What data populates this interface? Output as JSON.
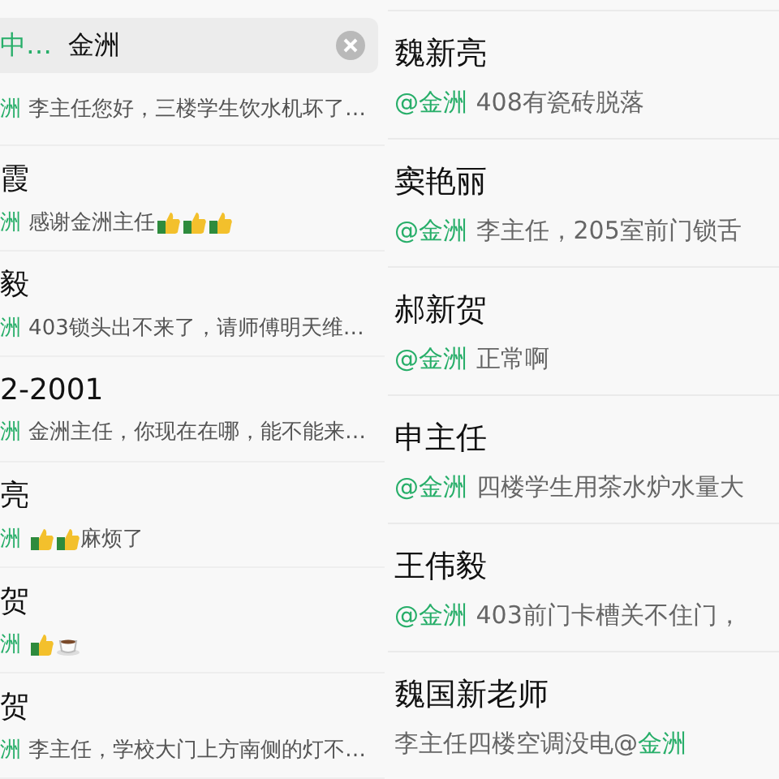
{
  "left_panel": {
    "search": {
      "scope": "中…",
      "value": "金洲"
    },
    "first_message": [
      {
        "kind": "mention",
        "text": "洲"
      },
      {
        "kind": "text",
        "text": "李主任您好，三楼学生饮水机坏了…"
      }
    ],
    "results": [
      {
        "name": "霞",
        "message": [
          {
            "kind": "mention",
            "text": "洲"
          },
          {
            "kind": "text",
            "text": "感谢金洲主任"
          },
          {
            "kind": "thumbs-up"
          },
          {
            "kind": "thumbs-up"
          },
          {
            "kind": "thumbs-up"
          }
        ]
      },
      {
        "name": "毅",
        "message": [
          {
            "kind": "mention",
            "text": "洲"
          },
          {
            "kind": "text",
            "text": "403锁头出不来了，请师傅明天维…"
          }
        ]
      },
      {
        "name": "2-2001",
        "message": [
          {
            "kind": "mention",
            "text": "洲"
          },
          {
            "kind": "text",
            "text": "金洲主任，你现在在哪，能不能来…"
          }
        ]
      },
      {
        "name": "亮",
        "message": [
          {
            "kind": "mention",
            "text": "洲"
          },
          {
            "kind": "thumbs-up"
          },
          {
            "kind": "thumbs-up"
          },
          {
            "kind": "text",
            "text": "麻烦了"
          }
        ]
      },
      {
        "name": "贺",
        "message": [
          {
            "kind": "mention",
            "text": "洲"
          },
          {
            "kind": "thumbs-up"
          },
          {
            "kind": "coffee"
          }
        ]
      },
      {
        "name": "贺",
        "message": [
          {
            "kind": "mention",
            "text": "洲"
          },
          {
            "kind": "text",
            "text": "李主任，学校大门上方南侧的灯不…"
          }
        ]
      }
    ]
  },
  "right_panel": {
    "results": [
      {
        "name": "魏新亮",
        "message": [
          {
            "kind": "mention",
            "text": "@金洲"
          },
          {
            "kind": "text",
            "text": "408有瓷砖脱落"
          }
        ]
      },
      {
        "name": "窦艳丽",
        "message": [
          {
            "kind": "mention",
            "text": "@金洲"
          },
          {
            "kind": "text",
            "text": "李主任，205室前门锁舌"
          }
        ]
      },
      {
        "name": "郝新贺",
        "message": [
          {
            "kind": "mention",
            "text": "@金洲"
          },
          {
            "kind": "text",
            "text": "正常啊"
          }
        ]
      },
      {
        "name": "申主任",
        "message": [
          {
            "kind": "mention",
            "text": "@金洲"
          },
          {
            "kind": "text",
            "text": "四楼学生用茶水炉水量大"
          }
        ]
      },
      {
        "name": "王伟毅",
        "message": [
          {
            "kind": "mention",
            "text": "@金洲"
          },
          {
            "kind": "text",
            "text": "403前门卡槽关不住门，"
          }
        ]
      },
      {
        "name": "魏国新老师",
        "message": [
          {
            "kind": "text",
            "text": "李主任四楼空调没电@"
          },
          {
            "kind": "mention",
            "text": "金洲"
          }
        ]
      }
    ]
  }
}
